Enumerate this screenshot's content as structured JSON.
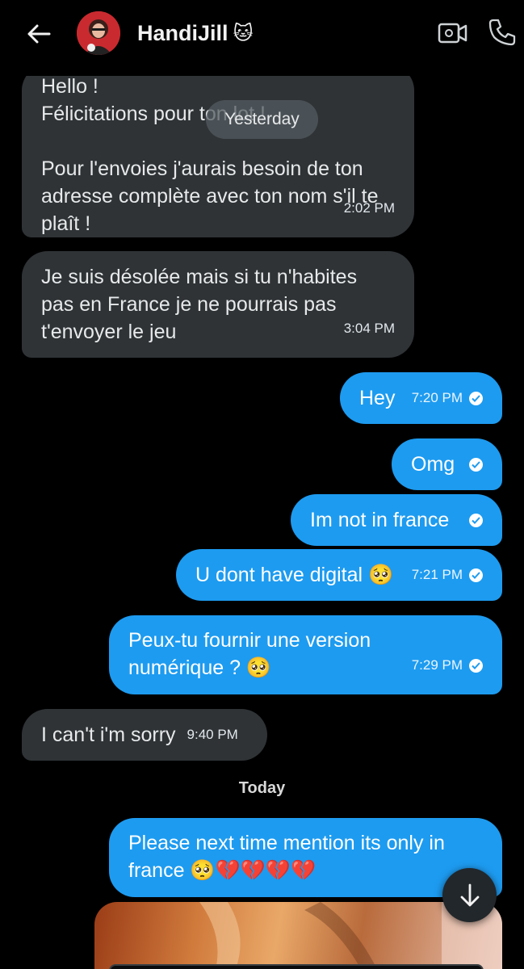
{
  "header": {
    "contact_name": "HandiJill",
    "name_emoji": "🐱",
    "back_icon": "arrow-left-icon",
    "video_icon": "video-call-icon",
    "call_icon": "phone-icon"
  },
  "dividers": {
    "yesterday": "Yesterday",
    "today": "Today"
  },
  "messages": [
    {
      "dir": "in",
      "text": "Hello !\nFélicitations pour ton lot !\n\nPour l'envoies j'aurais besoin de ton adresse complète avec ton nom s'il te plaît !",
      "time": "2:02 PM"
    },
    {
      "dir": "in",
      "text": "Je suis désolée mais si tu n'habites pas en France je ne pourrais pas t'envoyer le jeu",
      "time": "3:04 PM"
    },
    {
      "dir": "out",
      "text": "Hey",
      "time": "7:20 PM",
      "read": true
    },
    {
      "dir": "out",
      "text": "Omg",
      "time": "",
      "read": true
    },
    {
      "dir": "out",
      "text": "Im not in france",
      "time": "",
      "read": true
    },
    {
      "dir": "out",
      "text": "U dont have digital 🥺",
      "time": "7:21 PM",
      "read": true
    },
    {
      "dir": "out",
      "text": "Peux-tu fournir une version numérique ? 🥺",
      "time": "7:29 PM",
      "read": true
    },
    {
      "dir": "in",
      "text": "I can't i'm sorry",
      "time": "9:40 PM"
    },
    {
      "dir": "out",
      "text": "Please next time mention its only in france 🥺💔💔💔💔",
      "time": ""
    }
  ],
  "colors": {
    "background": "#000000",
    "incoming_bubble": "#2f3336",
    "outgoing_bubble": "#1d9bf0"
  },
  "scroll_button_icon": "arrow-down-icon"
}
